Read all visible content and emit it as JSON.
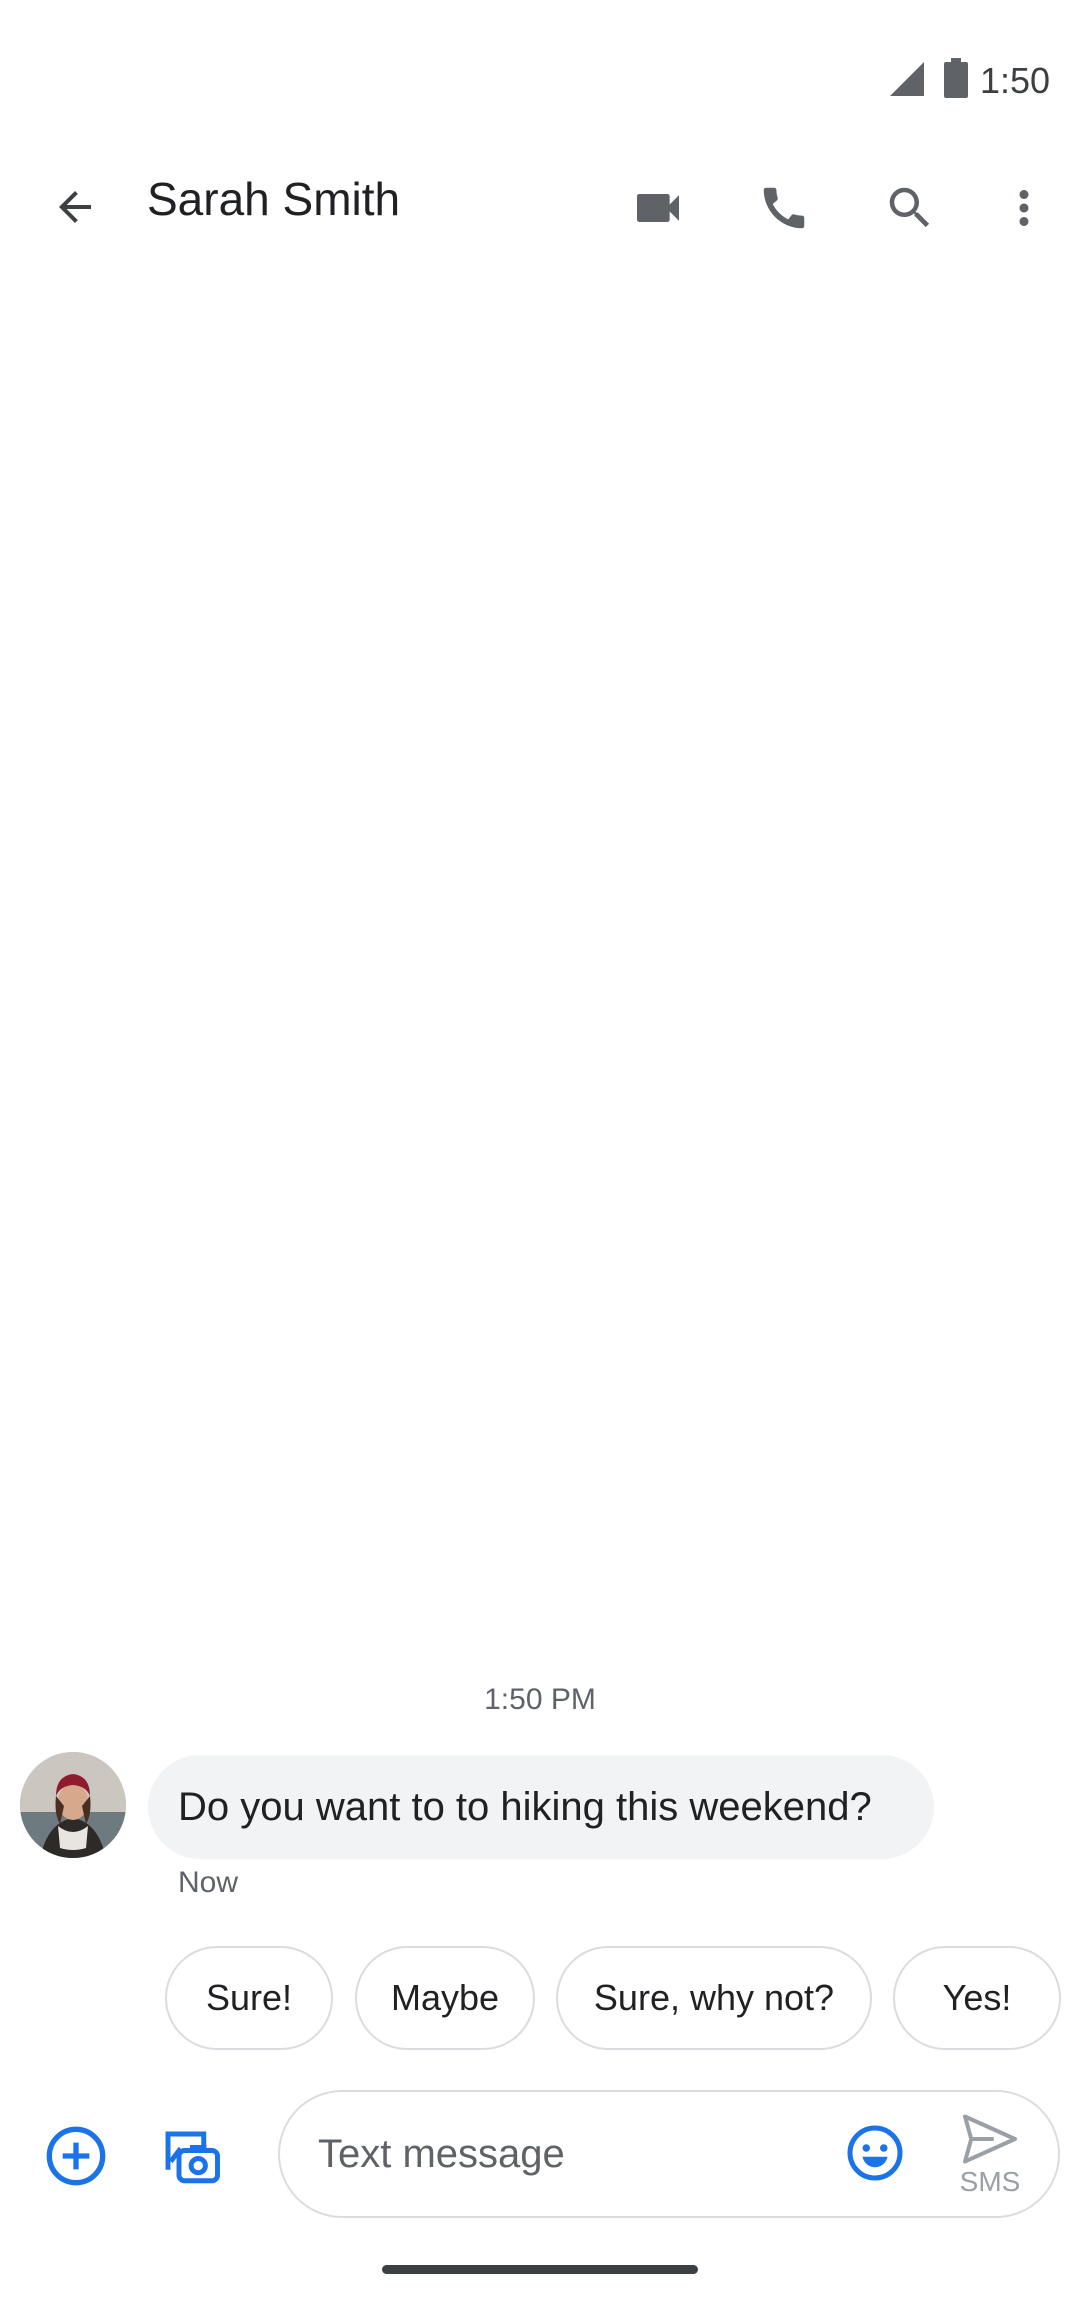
{
  "status_bar": {
    "time": "1:50",
    "icons": [
      "cellular-signal-icon",
      "battery-icon"
    ]
  },
  "app_bar": {
    "back_icon": "arrow-back-icon",
    "contact_name": "Sarah Smith",
    "actions": [
      "video-call-icon",
      "phone-icon",
      "search-icon",
      "more-vert-icon"
    ]
  },
  "conversation": {
    "timestamp": "1:50 PM",
    "messages": [
      {
        "sender": "Sarah Smith",
        "text": "Do you want to to hiking this weekend?",
        "time": "Now"
      }
    ]
  },
  "smart_replies": [
    "Sure!",
    "Maybe",
    "Sure, why not?",
    "Yes!"
  ],
  "compose": {
    "placeholder": "Text message",
    "send_label": "SMS",
    "icons": [
      "add-circle-icon",
      "gallery-camera-icon",
      "emoji-icon",
      "send-icon"
    ]
  },
  "colors": {
    "accent": "#1a73e8",
    "icon_gray": "#5f6368",
    "bubble_bg": "#f1f3f4",
    "chip_border": "#dadce0"
  }
}
